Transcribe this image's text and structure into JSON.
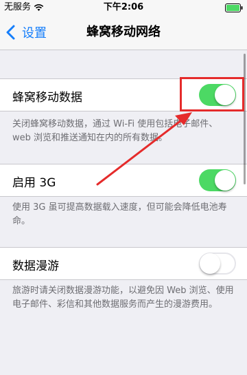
{
  "status_bar": {
    "carrier": "无服务",
    "time": "下午2:06"
  },
  "nav": {
    "back_label": "设置",
    "title": "蜂窝移动网络"
  },
  "settings": [
    {
      "label": "蜂窝移动数据",
      "on": true,
      "footnote": "关闭蜂窝移动数据，通过 Wi-Fi 使用包括电子邮件、web 浏览和推送通知在内的所有数据。"
    },
    {
      "label": "启用 3G",
      "on": true,
      "footnote": "使用 3G 虽可提高数据载入速度，但可能会降低电池寿命。"
    },
    {
      "label": "数据漫游",
      "on": false,
      "footnote": "旅游时请关闭数据漫游功能，以避免因 Web 浏览、使用电子邮件、彩信和其他数据服务而产生的漫游费用。"
    }
  ],
  "colors": {
    "accent": "#157efb",
    "toggle_on": "#4cd964",
    "annotation": "#e52b2b"
  }
}
